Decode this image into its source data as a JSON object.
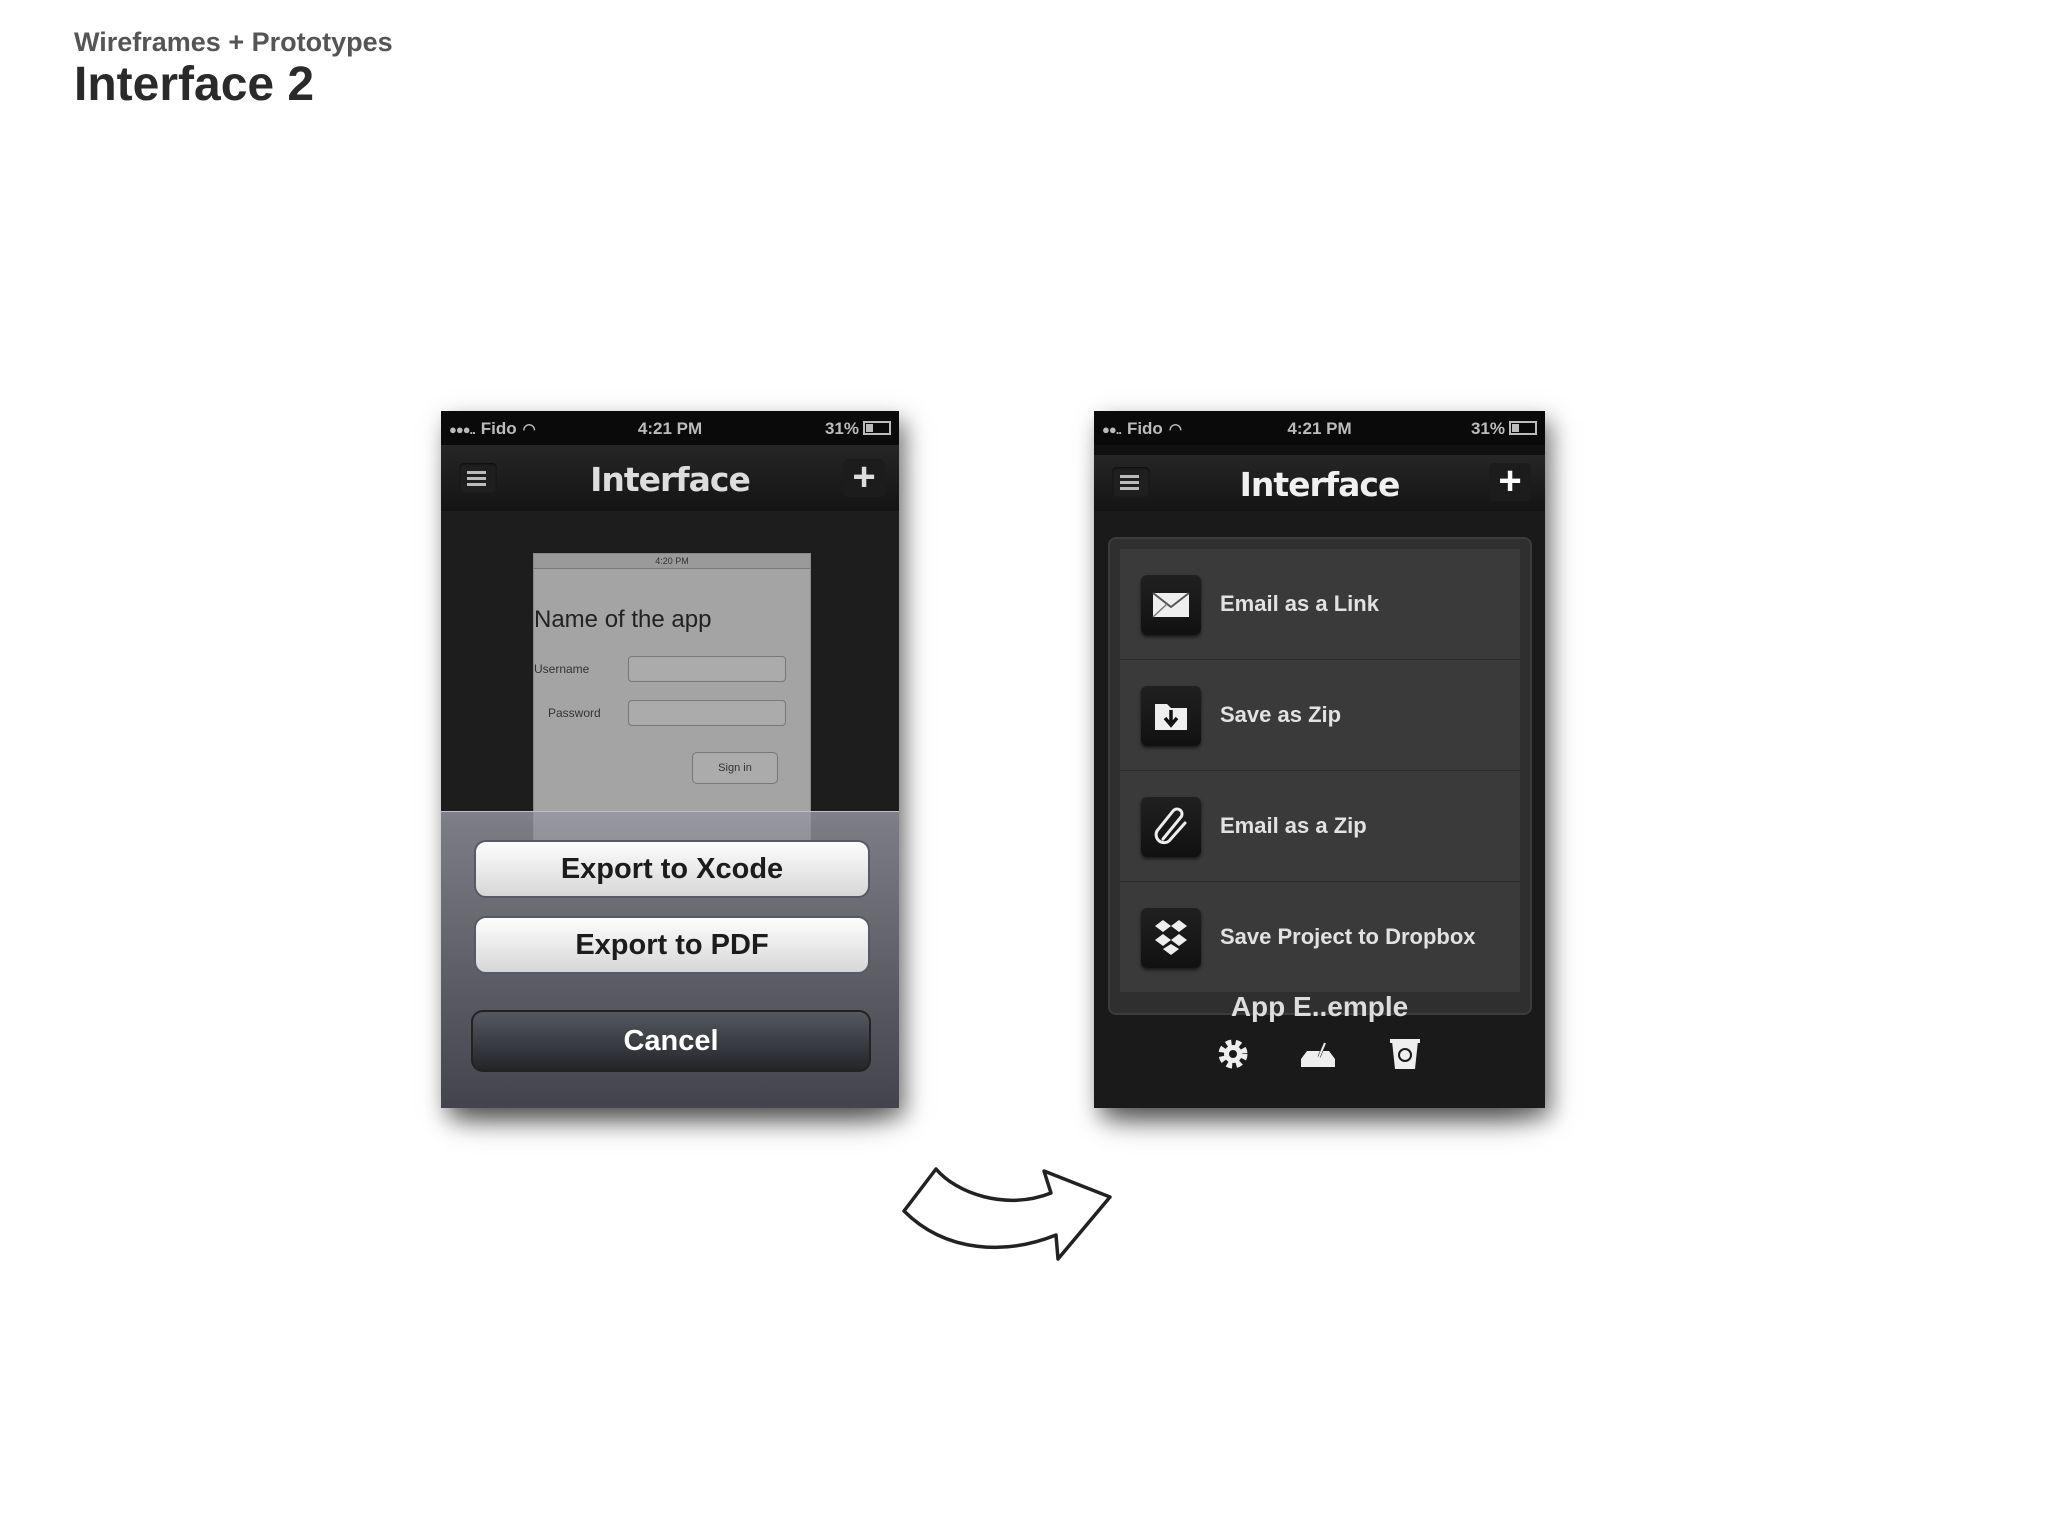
{
  "slide": {
    "subtitle": "Wireframes + Prototypes",
    "title": "Interface 2"
  },
  "left_phone": {
    "status": {
      "carrier": "Fido",
      "time": "4:21 PM",
      "battery": "31%"
    },
    "nav": {
      "title": "Interface",
      "menu_icon": "list-icon",
      "add_icon": "plus-icon"
    },
    "preview": {
      "time": "4:20 PM",
      "title": "Name of the app",
      "username_label": "Username",
      "password_label": "Password",
      "signin_label": "Sign in"
    },
    "action_sheet": {
      "export_xcode": "Export to Xcode",
      "export_pdf": "Export to PDF",
      "cancel": "Cancel"
    }
  },
  "right_phone": {
    "status": {
      "carrier": "Fido",
      "time": "4:21 PM",
      "battery": "31%"
    },
    "nav": {
      "title": "Interface",
      "menu_icon": "list-icon",
      "add_icon": "plus-icon"
    },
    "share_menu": [
      {
        "label": "Email as a Link",
        "icon": "envelope-icon"
      },
      {
        "label": "Save as Zip",
        "icon": "download-folder-icon"
      },
      {
        "label": "Email as a Zip",
        "icon": "paperclip-icon"
      },
      {
        "label": "Save Project to Dropbox",
        "icon": "dropbox-icon"
      }
    ],
    "bottom": {
      "title": "App E..emple",
      "icons": [
        "gear-icon",
        "export-tray-icon",
        "recycle-bin-icon"
      ]
    }
  },
  "transition_arrow": "curved-arrow-icon"
}
